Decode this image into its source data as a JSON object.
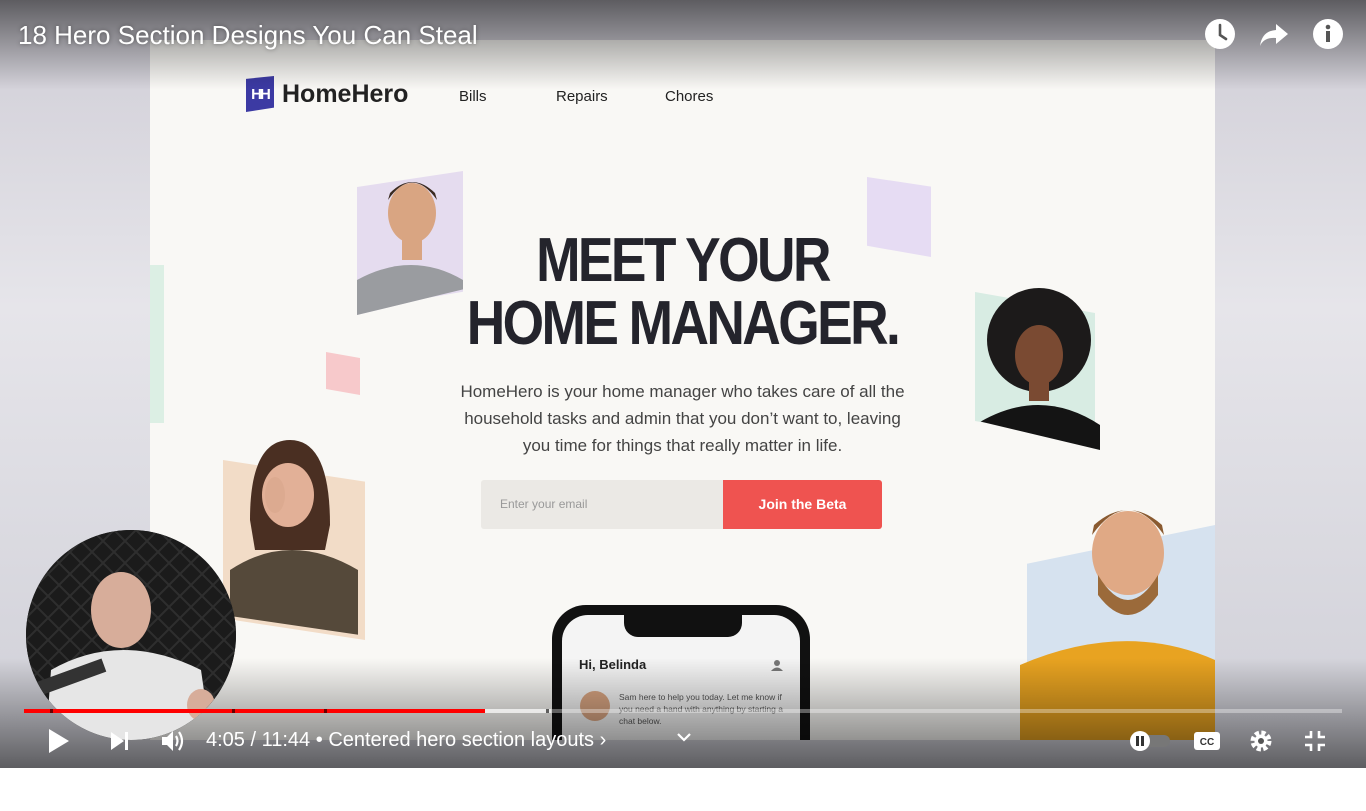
{
  "video": {
    "title": "18 Hero Section Designs You Can Steal"
  },
  "site": {
    "logo_mark": "HH",
    "logo_text": "HomeHero",
    "nav": [
      "Bills",
      "Repairs",
      "Chores"
    ],
    "headline_line1": "MEET YOUR",
    "headline_line2": "HOME MANAGER.",
    "subtext": "HomeHero is your home manager who takes care of all the household tasks and admin that you don’t want to, leaving you time for things that really matter in life.",
    "email_placeholder": "Enter your email",
    "cta": "Join the Beta",
    "phone": {
      "greeting": "Hi, Belinda",
      "message": "Sam here to help you today. Let me know if you need a hand with anything by starting a chat below."
    }
  },
  "controls": {
    "current_time": "4:05",
    "duration": "11:44",
    "chapter": "Centered hero section layouts",
    "progress": 0.35,
    "buffered": 0.4,
    "autoplay": "off"
  },
  "colors": {
    "accent_red": "#ef5350",
    "brand_indigo": "#3c3aa3",
    "progress_red": "#ff0000"
  },
  "icons": [
    "watch-later-icon",
    "share-icon",
    "info-icon",
    "play-icon",
    "next-icon",
    "volume-icon",
    "chevron-down-icon",
    "autoplay-toggle-icon",
    "captions-icon",
    "settings-icon",
    "exit-fullscreen-icon"
  ]
}
